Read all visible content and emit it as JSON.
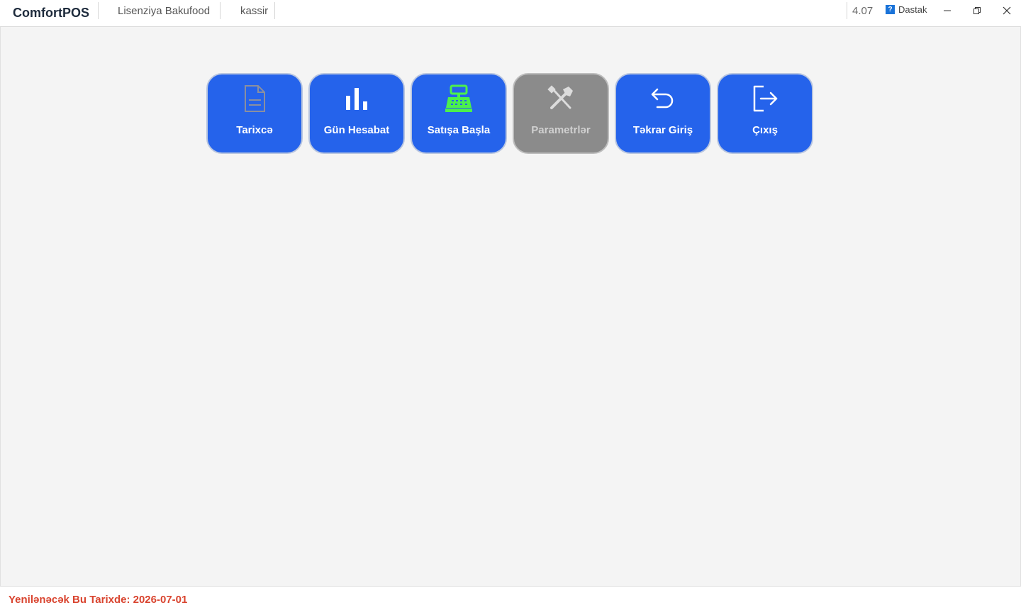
{
  "titlebar": {
    "app_name": "ComfortPOS",
    "license": "Lisenziya Bakufood",
    "user": "kassir",
    "version": "4.07",
    "support_label": "Dastak",
    "support_icon": "question-icon"
  },
  "tiles": [
    {
      "label": "Tarixcə",
      "icon": "document-icon",
      "enabled": true
    },
    {
      "label": "Gün Hesabat",
      "icon": "bar-chart-icon",
      "enabled": true
    },
    {
      "label": "Satışa Başla",
      "icon": "cash-register-icon",
      "enabled": true
    },
    {
      "label": "Parametrlər",
      "icon": "tools-icon",
      "enabled": false
    },
    {
      "label": "Təkrar Giriş",
      "icon": "undo-arrow-icon",
      "enabled": true
    },
    {
      "label": "Çıxış",
      "icon": "logout-icon",
      "enabled": true
    }
  ],
  "footer": {
    "renew_text": "Yenilənəcək Bu Tarixde: 2026-07-01"
  },
  "colors": {
    "tile_blue": "#2563eb",
    "tile_disabled": "#8b8b8b",
    "register_green": "#4cf04c",
    "footer_red": "#d9442f"
  }
}
